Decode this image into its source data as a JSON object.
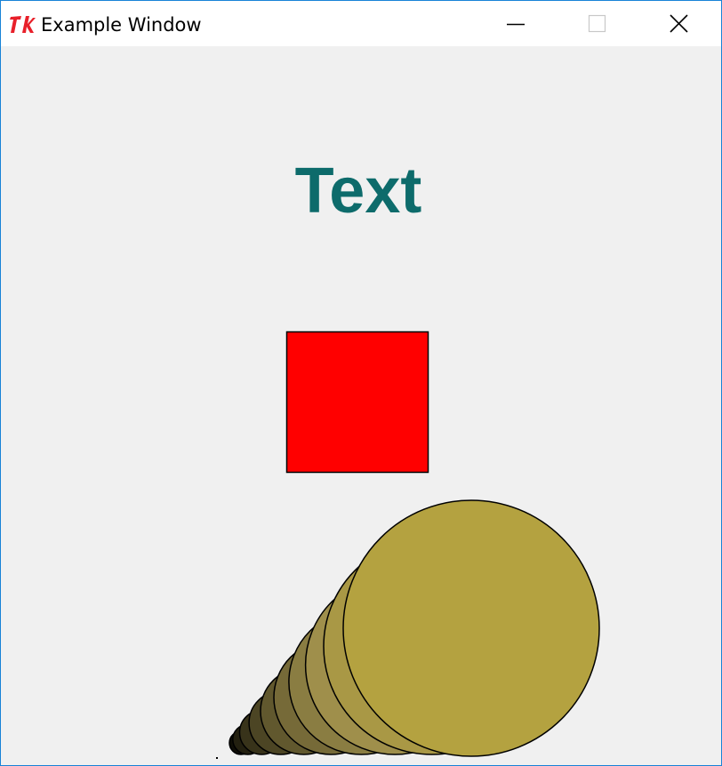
{
  "window": {
    "title": "Example Window",
    "app_icon": "tk-feather-icon",
    "buttons": {
      "minimize": "minimize-icon",
      "maximize": "maximize-icon",
      "close": "close-icon"
    }
  },
  "canvas": {
    "background": "#f0f0f0",
    "label": {
      "text": "Text",
      "color": "#0d6b6b"
    },
    "square": {
      "fill": "#ff0000",
      "outline": "#000000"
    },
    "circles": {
      "count": 10,
      "outline": "#000000",
      "fills": [
        "#0f0e06",
        "#232010",
        "#38331a",
        "#4c4524",
        "#61582e",
        "#766a38",
        "#8a7d42",
        "#9f8f4b",
        "#a99845",
        "#b4a240"
      ]
    }
  }
}
